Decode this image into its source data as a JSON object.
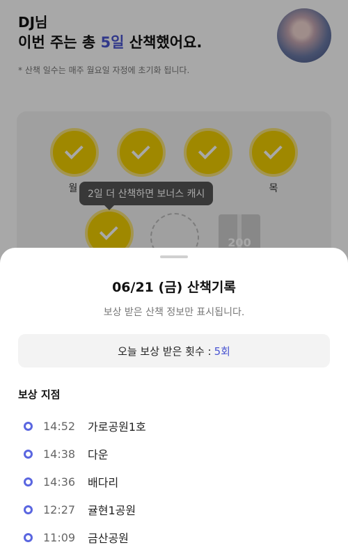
{
  "header": {
    "user": "DJ님",
    "summary_prefix": "이번 주는 총 ",
    "summary_days": "5일",
    "summary_suffix": " 산책했어요.",
    "note": "* 산책 일수는 매주 월요일 자정에 초기화 됩니다."
  },
  "week": {
    "days": [
      "월",
      "목"
    ],
    "tooltip": "2일 더 산책하면 보너스 캐시",
    "bonus_amount": "200"
  },
  "sheet": {
    "title": "06/21 (금) 산책기록",
    "subtitle": "보상 받은 산책 정보만 표시됩니다.",
    "count_label": "오늘 보상 받은 횟수 :",
    "count_value": "5회",
    "section_title": "보상 지점",
    "records": [
      {
        "time": "14:52",
        "place": "가로공원1호"
      },
      {
        "time": "14:38",
        "place": "다운"
      },
      {
        "time": "14:36",
        "place": "배다리"
      },
      {
        "time": "12:27",
        "place": "귤현1공원"
      },
      {
        "time": "11:09",
        "place": "금산공원"
      }
    ]
  },
  "colors": {
    "accent": "#4b56d2",
    "check": "#f2cf00"
  }
}
